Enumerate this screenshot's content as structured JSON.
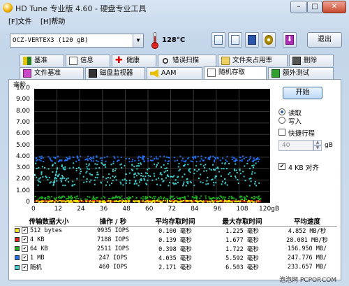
{
  "window": {
    "title": "HD Tune 专业版 4.60 - 硬盘专业工具",
    "minimize": "–",
    "maximize": "□",
    "close": "✕"
  },
  "menu": {
    "file": "[F]文件",
    "help": "[H]帮助"
  },
  "toolbar": {
    "drive": "OCZ-VERTEX3  (120 gB)",
    "temperature": "128°C",
    "exit": "退出"
  },
  "tabs_row1": [
    "基准",
    "信息",
    "健康",
    "错误扫描",
    "文件夹占用率",
    "删除"
  ],
  "tabs_row2": [
    "文件基准",
    "磁盘监视器",
    "AAM",
    "随机存取",
    "额外测试"
  ],
  "active_tab": "随机存取",
  "controls": {
    "start": "开始",
    "read": "读取",
    "write": "写入",
    "quick_test": "快捷行程",
    "quick_value": "40",
    "quick_unit": "gB",
    "align": "4 KB 对齐"
  },
  "chart_data": {
    "type": "scatter",
    "ylabel": "毫秒",
    "ylim": [
      0,
      10
    ],
    "y_ticks": [
      "10.0",
      "9.00",
      "8.00",
      "7.00",
      "6.00",
      "5.00",
      "4.00",
      "3.00",
      "2.00",
      "1.00",
      "0"
    ],
    "xlim": [
      0,
      120
    ],
    "x_ticks": [
      "0",
      "12",
      "24",
      "36",
      "48",
      "60",
      "72",
      "84",
      "96",
      "108",
      "120gB"
    ],
    "series": [
      {
        "name": "512 bytes",
        "color": "#e8e000",
        "band": [
          0.05,
          0.2
        ]
      },
      {
        "name": "4 KB",
        "color": "#e02020",
        "band": [
          0.1,
          0.2
        ]
      },
      {
        "name": "64 KB",
        "color": "#20b020",
        "band": [
          0.3,
          0.6
        ]
      },
      {
        "name": "1 MB",
        "color": "#2070f0",
        "band": [
          3.6,
          4.1
        ]
      },
      {
        "name": "随机",
        "color": "#40d0d0",
        "band": [
          1.5,
          3.5
        ]
      }
    ]
  },
  "results": {
    "headers": [
      "传输数据大小",
      "操作 / 秒",
      "平均存取时间",
      "最大存取时间",
      "平均速度"
    ],
    "rows": [
      {
        "color": "#f0e020",
        "size": "512 bytes",
        "ops": "9935 IOPS",
        "avg": "0.100 毫秒",
        "max": "1.225 毫秒",
        "speed": "4.852 MB/秒"
      },
      {
        "color": "#e02020",
        "size": "4 KB",
        "ops": "7188 IOPS",
        "avg": "0.139 毫秒",
        "max": "1.677 毫秒",
        "speed": "28.081 MB/秒"
      },
      {
        "color": "#20b020",
        "size": "64 KB",
        "ops": "2511 IOPS",
        "avg": "0.398 毫秒",
        "max": "1.722 毫秒",
        "speed": "156.950 MB/"
      },
      {
        "color": "#2070f0",
        "size": "1 MB",
        "ops": "247 IOPS",
        "avg": "4.035 毫秒",
        "max": "5.592 毫秒",
        "speed": "247.776 MB/"
      },
      {
        "color": "#40d0d0",
        "size": "随机",
        "ops": "460 IOPS",
        "avg": "2.171 毫秒",
        "max": "6.503 毫秒",
        "speed": "233.657 MB/"
      }
    ]
  },
  "watermark": "泡泡网 PCPOP.COM"
}
